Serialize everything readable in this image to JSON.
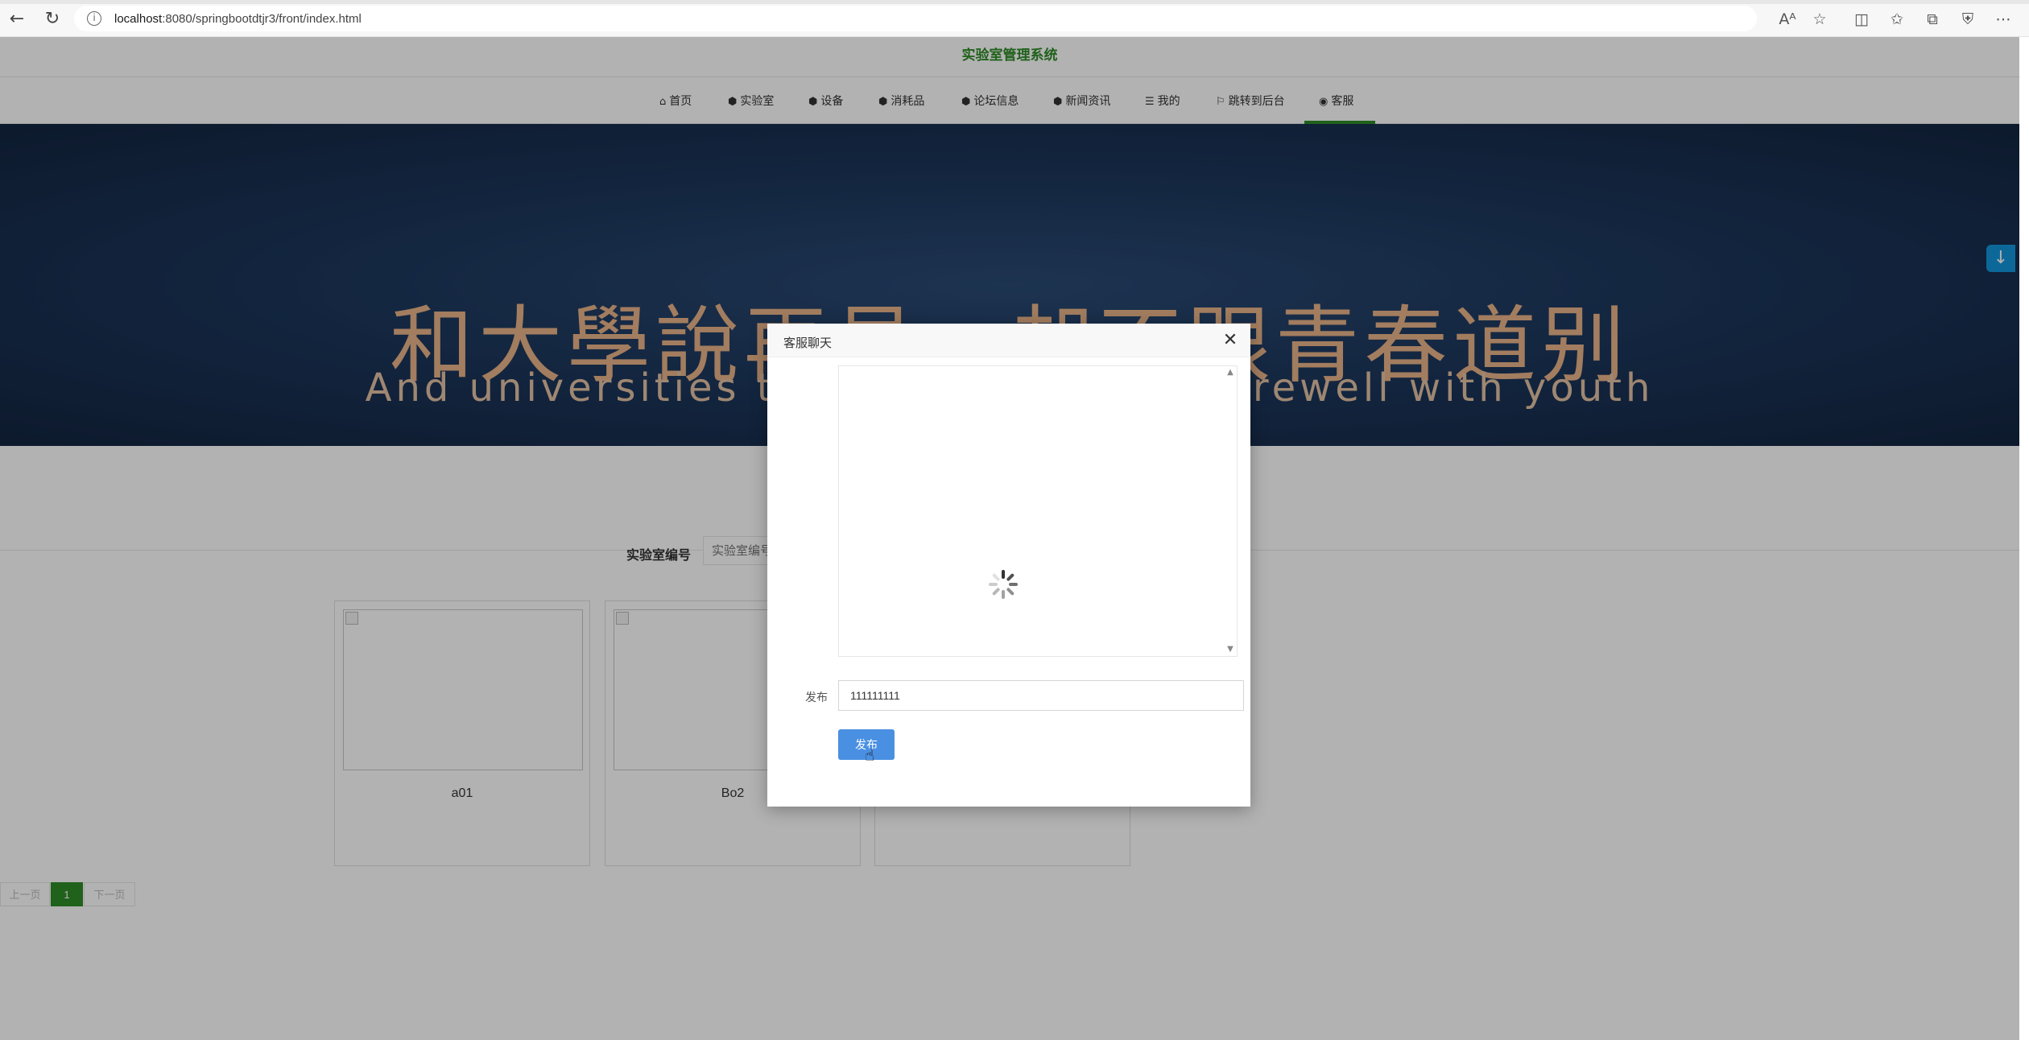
{
  "browser": {
    "url_host": "localhost",
    "url_rest": ":8080/springbootdtjr3/front/index.html",
    "icons": [
      "back-arrow-icon",
      "refresh-icon",
      "info-icon",
      "read-aloud-icon",
      "favorite-star-icon",
      "split-screen-icon",
      "favorites-icon",
      "collections-icon",
      "extensions-icon",
      "more-icon"
    ]
  },
  "site": {
    "title": "实验室管理系统",
    "nav": [
      {
        "icon": "home-icon",
        "glyph": "⌂",
        "label": "首页"
      },
      {
        "icon": "cube-icon",
        "glyph": "⬢",
        "label": "实验室"
      },
      {
        "icon": "cube-icon",
        "glyph": "⬢",
        "label": "设备"
      },
      {
        "icon": "cube-icon",
        "glyph": "⬢",
        "label": "消耗品"
      },
      {
        "icon": "cube-icon",
        "glyph": "⬢",
        "label": "论坛信息"
      },
      {
        "icon": "cube-icon",
        "glyph": "⬢",
        "label": "新闻资讯"
      },
      {
        "icon": "list-icon",
        "glyph": "☰",
        "label": "我的"
      },
      {
        "icon": "flag-icon",
        "glyph": "⚐",
        "label": "跳转到后台"
      },
      {
        "icon": "support-icon",
        "glyph": "◉",
        "label": "客服"
      }
    ],
    "active_nav": "客服",
    "banner": {
      "cn_text": "和大學說再見，却不跟青春道别",
      "en_text": "And universities to sc",
      "en_text_tail": "farewell with youth"
    },
    "search": {
      "label": "实验室编号",
      "placeholder": "实验室编号"
    },
    "cards": [
      {
        "name": "a01"
      },
      {
        "name": "Bo2"
      },
      {
        "name": ""
      }
    ],
    "pager": {
      "prev": "上一页",
      "current": "1",
      "next": "下一页"
    }
  },
  "dialog": {
    "title": "客服聊天",
    "form_label": "发布",
    "message_value": "111111111",
    "send_label": "发布"
  },
  "colors": {
    "brand_green": "#2e8b27",
    "button_blue": "#4a90e2",
    "float_blue": "#1296db",
    "banner_text": "#e8b489"
  }
}
